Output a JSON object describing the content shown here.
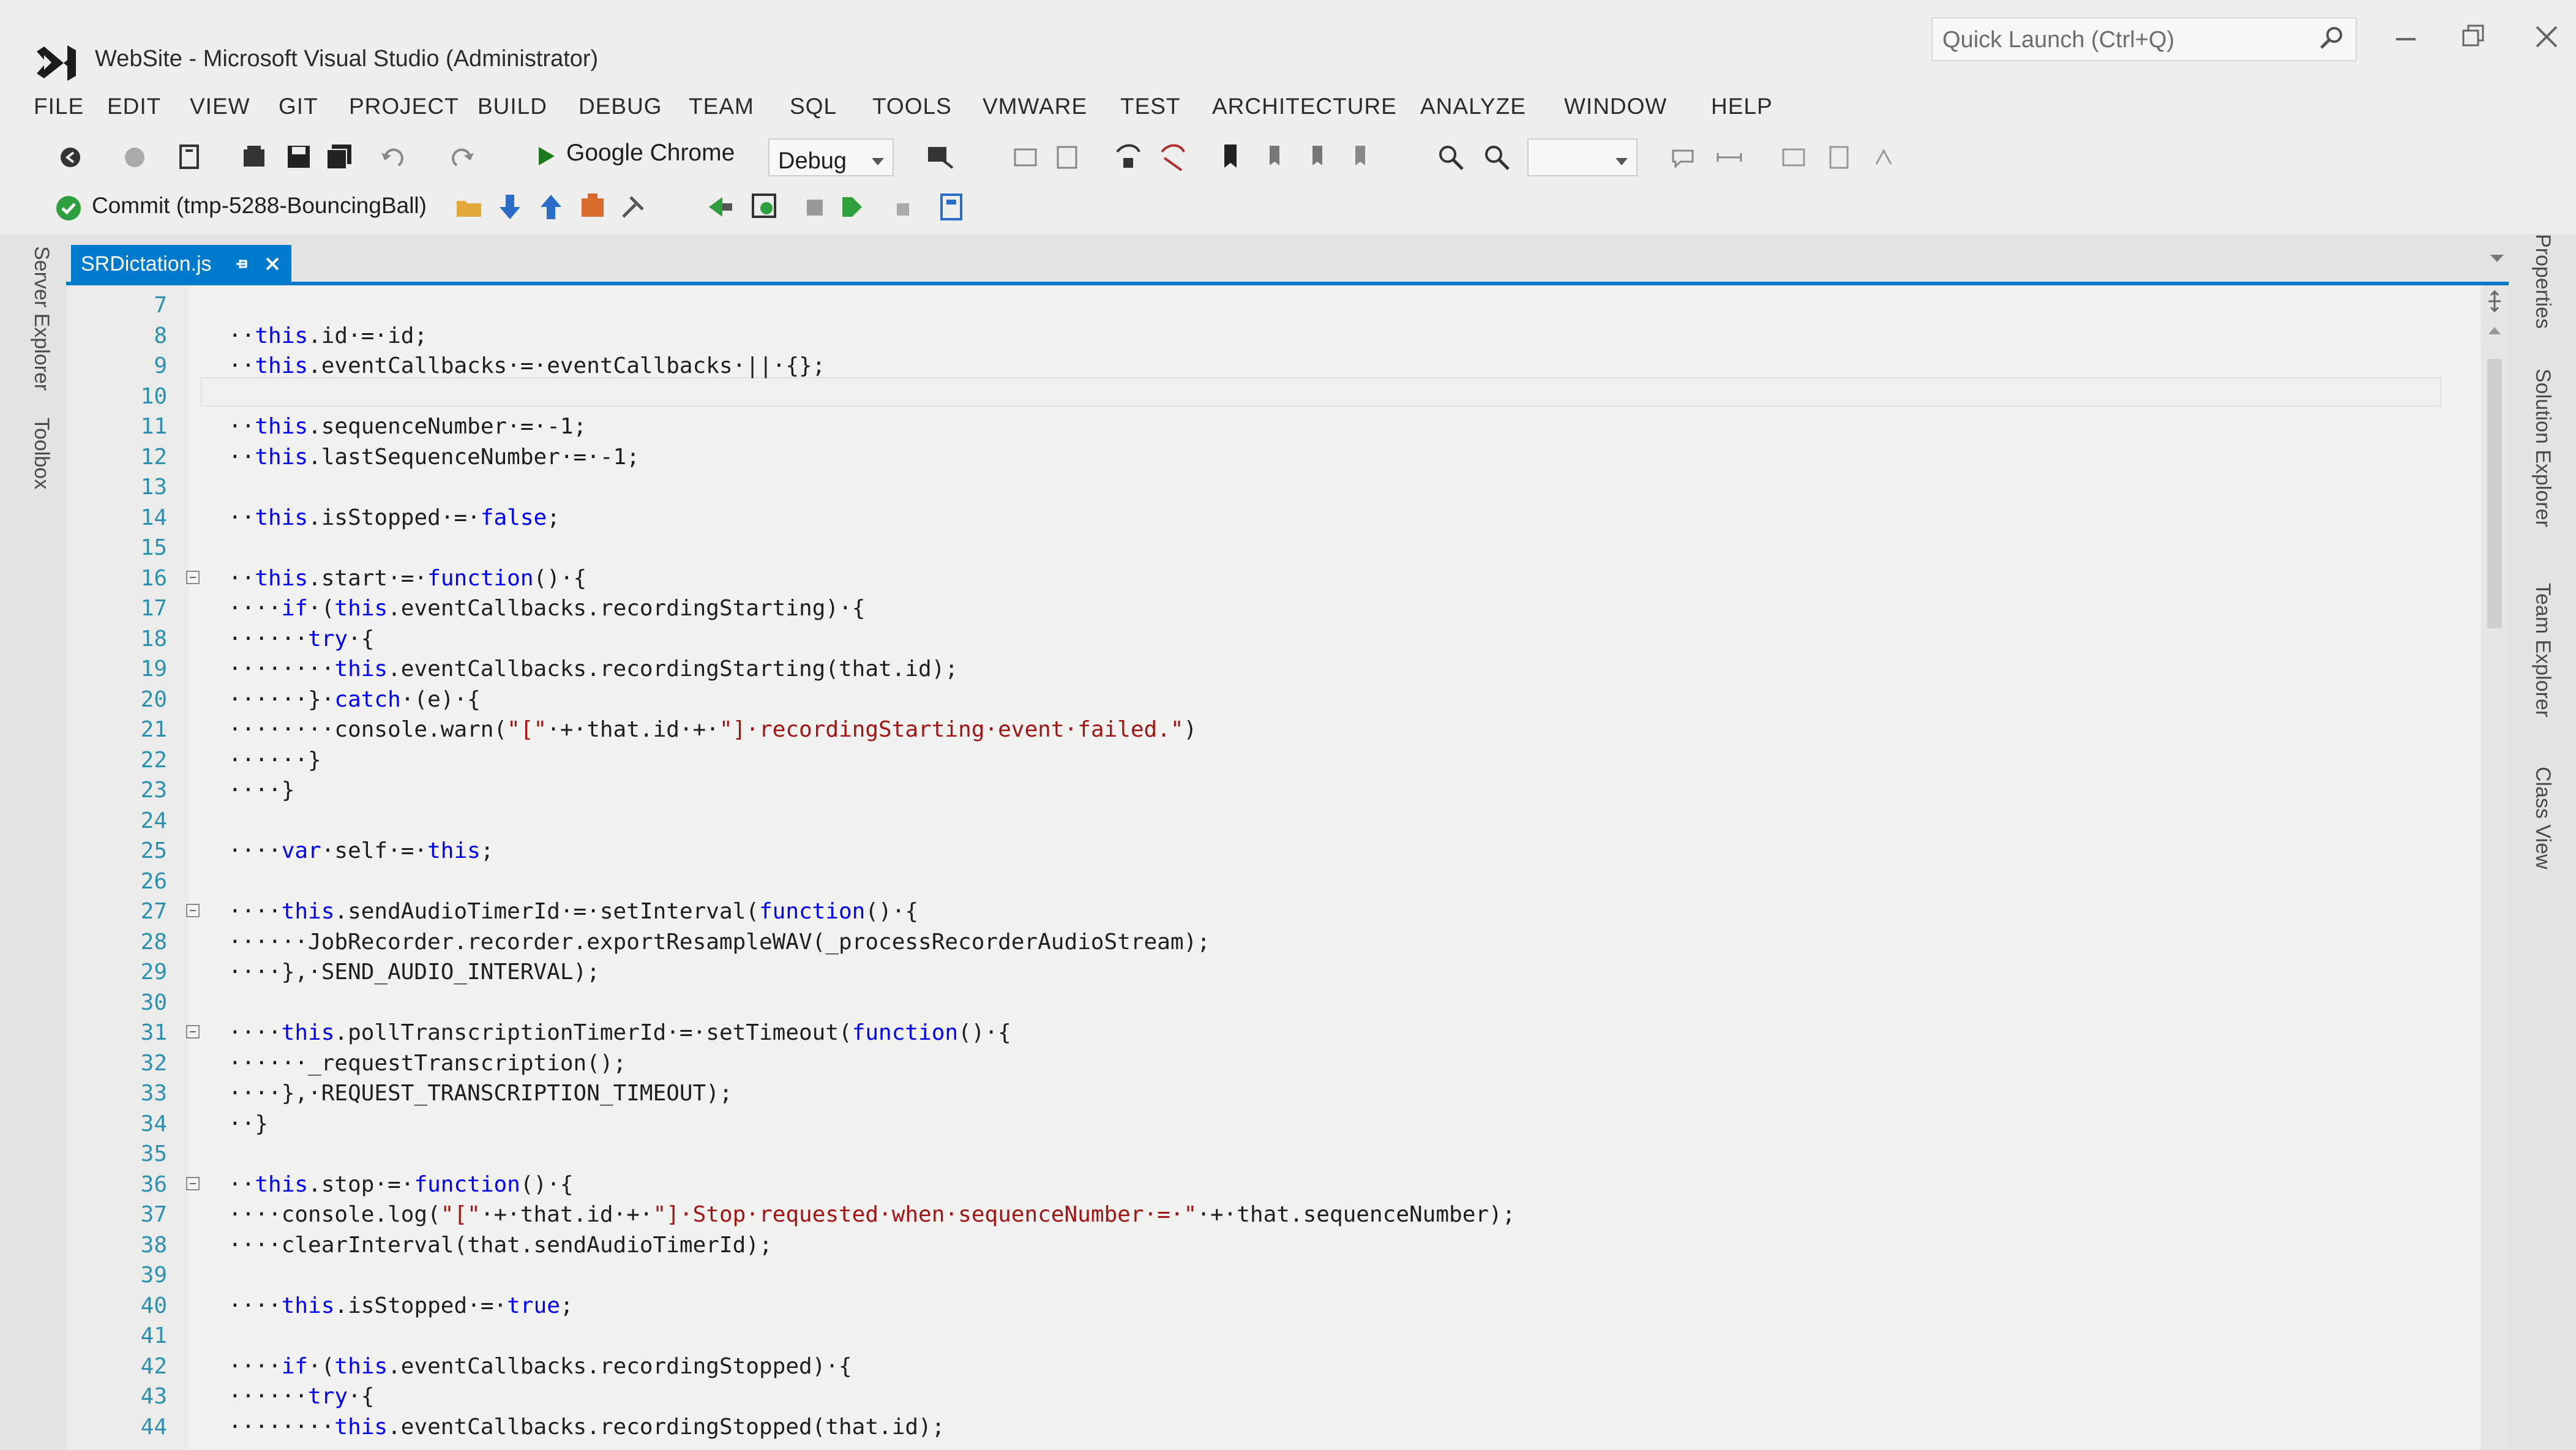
{
  "window": {
    "title": "WebSite - Microsoft Visual Studio (Administrator)",
    "quick_launch_placeholder": "Quick Launch (Ctrl+Q)"
  },
  "menu": {
    "items": [
      "FILE",
      "EDIT",
      "VIEW",
      "GIT",
      "PROJECT",
      "BUILD",
      "DEBUG",
      "TEAM",
      "SQL",
      "TOOLS",
      "VMWARE",
      "TEST",
      "ARCHITECTURE",
      "ANALYZE",
      "WINDOW",
      "HELP"
    ]
  },
  "toolbar": {
    "run_target": "Google Chrome",
    "configuration": "Debug",
    "commit_label": "Commit (tmp-5288-BouncingBall)"
  },
  "side_panels": {
    "left": [
      "Server Explorer",
      "Toolbox"
    ],
    "right": [
      "Properties",
      "Solution Explorer",
      "Team Explorer",
      "Class View"
    ]
  },
  "editor": {
    "tab_label": "SRDictation.js",
    "lines": [
      {
        "n": "7",
        "code": ""
      },
      {
        "n": "8",
        "code": "··this.id·=·id;"
      },
      {
        "n": "9",
        "code": "··this.eventCallbacks·=·eventCallbacks·||·{};"
      },
      {
        "n": "10",
        "code": ""
      },
      {
        "n": "11",
        "code": "··this.sequenceNumber·=·-1;"
      },
      {
        "n": "12",
        "code": "··this.lastSequenceNumber·=·-1;"
      },
      {
        "n": "13",
        "code": ""
      },
      {
        "n": "14",
        "code": "··this.isStopped·=·false;"
      },
      {
        "n": "15",
        "code": ""
      },
      {
        "n": "16",
        "code": "··this.start·=·function()·{"
      },
      {
        "n": "17",
        "code": "····if·(this.eventCallbacks.recordingStarting)·{"
      },
      {
        "n": "18",
        "code": "······try·{"
      },
      {
        "n": "19",
        "code": "········this.eventCallbacks.recordingStarting(that.id);"
      },
      {
        "n": "20",
        "code": "······}·catch·(e)·{"
      },
      {
        "n": "21",
        "code": "········console.warn(\"[\"·+·that.id·+·\"]·recordingStarting·event·failed.\")"
      },
      {
        "n": "22",
        "code": "······}"
      },
      {
        "n": "23",
        "code": "····}"
      },
      {
        "n": "24",
        "code": ""
      },
      {
        "n": "25",
        "code": "····var·self·=·this;"
      },
      {
        "n": "26",
        "code": ""
      },
      {
        "n": "27",
        "code": "····this.sendAudioTimerId·=·setInterval(function()·{"
      },
      {
        "n": "28",
        "code": "······JobRecorder.recorder.exportResampleWAV(_processRecorderAudioStream);"
      },
      {
        "n": "29",
        "code": "····},·SEND_AUDIO_INTERVAL);"
      },
      {
        "n": "30",
        "code": ""
      },
      {
        "n": "31",
        "code": "····this.pollTranscriptionTimerId·=·setTimeout(function()·{"
      },
      {
        "n": "32",
        "code": "······_requestTranscription();"
      },
      {
        "n": "33",
        "code": "····},·REQUEST_TRANSCRIPTION_TIMEOUT);"
      },
      {
        "n": "34",
        "code": "··}"
      },
      {
        "n": "35",
        "code": ""
      },
      {
        "n": "36",
        "code": "··this.stop·=·function()·{"
      },
      {
        "n": "37",
        "code": "····console.log(\"[\"·+·that.id·+·\"]·Stop·requested·when·sequenceNumber·=·\"·+·that.sequenceNumber);"
      },
      {
        "n": "38",
        "code": "····clearInterval(that.sendAudioTimerId);"
      },
      {
        "n": "39",
        "code": ""
      },
      {
        "n": "40",
        "code": "····this.isStopped·=·true;"
      },
      {
        "n": "41",
        "code": ""
      },
      {
        "n": "42",
        "code": "····if·(this.eventCallbacks.recordingStopped)·{"
      },
      {
        "n": "43",
        "code": "······try·{"
      },
      {
        "n": "44",
        "code": "········this.eventCallbacks.recordingStopped(that.id);"
      }
    ],
    "folds": [
      "16",
      "27",
      "31",
      "36"
    ]
  },
  "colors": {
    "accent": "#007acc",
    "keyword": "#0000ff",
    "string": "#a31515",
    "line_number": "#2b91af"
  }
}
